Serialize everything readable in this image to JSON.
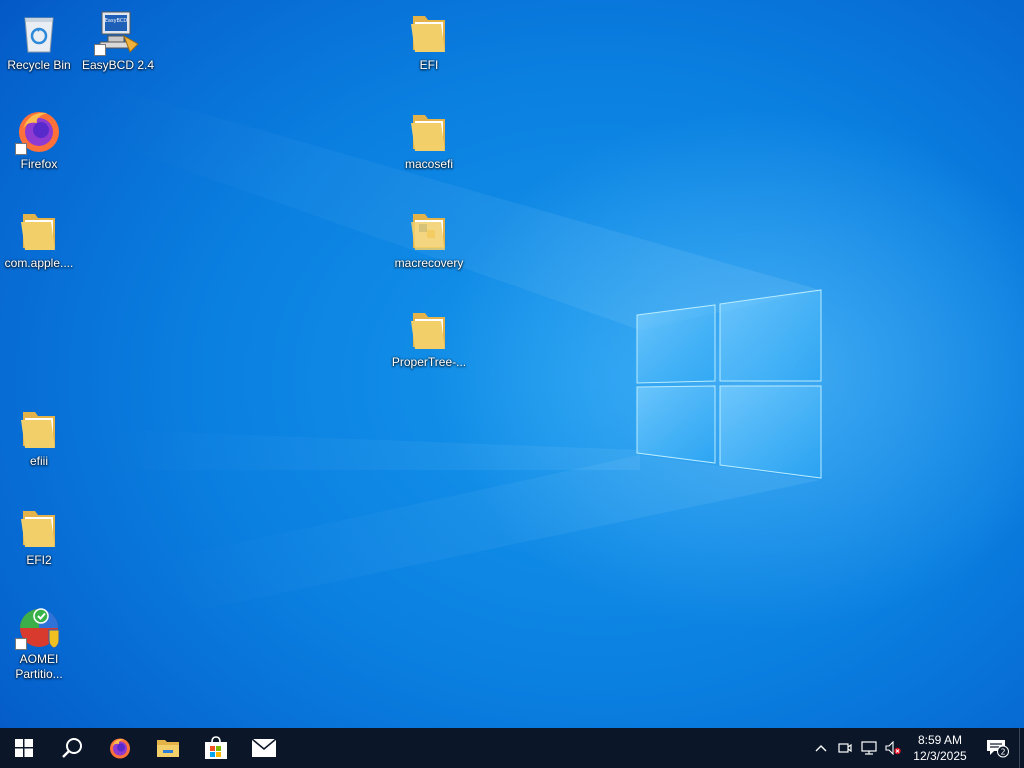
{
  "desktop": {
    "icons": [
      {
        "label": "Recycle Bin",
        "icon": "recycle-bin-icon"
      },
      {
        "label": "EasyBCD 2.4",
        "icon": "easybcd-icon"
      },
      {
        "label": "EFI",
        "icon": "folder-icon"
      },
      {
        "label": "Firefox",
        "icon": "firefox-icon"
      },
      {
        "label": "macosefi",
        "icon": "folder-icon"
      },
      {
        "label": "com.apple....",
        "icon": "folder-icon"
      },
      {
        "label": "macrecovery",
        "icon": "folder-icon"
      },
      {
        "label": "ProperTree-...",
        "icon": "folder-icon"
      },
      {
        "label": "efiii",
        "icon": "folder-icon"
      },
      {
        "label": "EFI2",
        "icon": "folder-icon"
      },
      {
        "label": "AOMEI Partitio...",
        "icon": "aomei-icon"
      }
    ]
  },
  "taskbar": {
    "pinned": [
      "start-icon",
      "search-icon",
      "firefox-icon",
      "file-explorer-icon",
      "microsoft-store-icon",
      "mail-icon"
    ],
    "tray": {
      "time": "8:59 AM",
      "date": "12/3/2025",
      "notification_count": "2"
    }
  },
  "colors": {
    "taskbar": "#0b1728",
    "wallpaper": "#0a7fe0",
    "folder": "#f3cf6a"
  }
}
